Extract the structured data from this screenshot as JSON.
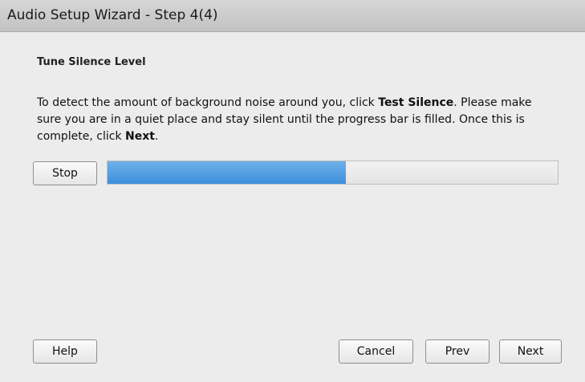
{
  "window": {
    "title": "Audio Setup Wizard - Step 4(4)"
  },
  "section": {
    "heading": "Tune Silence Level"
  },
  "description": {
    "part1": "To detect the amount of background noise around you, click ",
    "bold1": "Test Silence",
    "part2": ". Please make sure you are in a quiet place and stay silent until the progress bar is filled. Once this is complete, click ",
    "bold2": "Next",
    "part3": "."
  },
  "controls": {
    "stop_label": "Stop"
  },
  "progress": {
    "fraction": 0.53,
    "fill_color": "#4a9ae0"
  },
  "footer": {
    "help_label": "Help",
    "cancel_label": "Cancel",
    "prev_label": "Prev",
    "next_label": "Next"
  }
}
